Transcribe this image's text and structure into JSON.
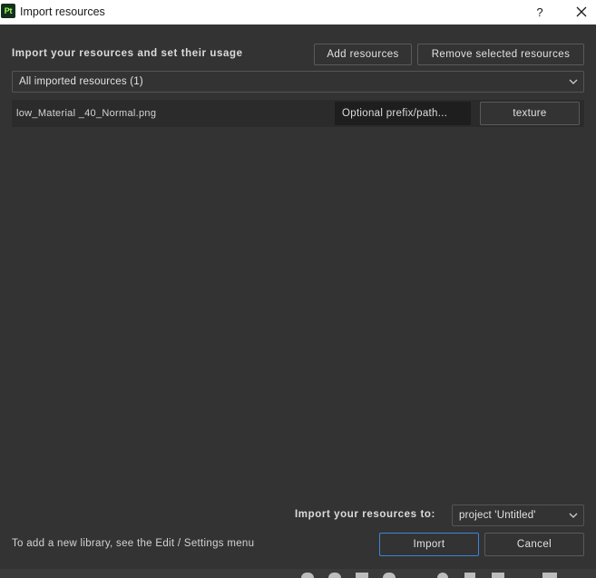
{
  "window": {
    "app_icon_label": "Pt",
    "title": "Import resources",
    "help_label": "?"
  },
  "header": {
    "heading": "Import your resources and set their usage",
    "add_label": "Add resources",
    "remove_label": "Remove selected resources"
  },
  "filter": {
    "selected": "All imported resources (1)"
  },
  "resources": [
    {
      "name": "low_Material _40_Normal.png",
      "prefix_placeholder": "Optional prefix/path...",
      "usage": "texture"
    }
  ],
  "destination": {
    "label": "Import your resources to:",
    "selected": "project 'Untitled'"
  },
  "footer": {
    "hint": "To add a new library, see the Edit / Settings menu",
    "import_label": "Import",
    "cancel_label": "Cancel"
  },
  "colors": {
    "background": "#333333",
    "list_row": "#2b2b2b",
    "input": "#1e1e1e",
    "accent_focus": "#3d84d6",
    "app_icon_bg": "#12301c",
    "app_icon_fg": "#9dff55"
  }
}
